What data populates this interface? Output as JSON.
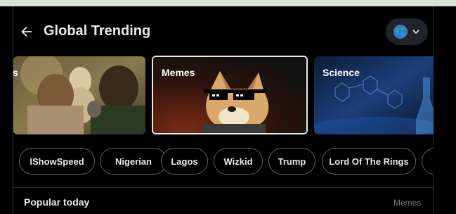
{
  "header": {
    "title": "Global Trending"
  },
  "cards": [
    {
      "label": "s"
    },
    {
      "label": "Memes"
    },
    {
      "label": "Science"
    }
  ],
  "chips": [
    "IShowSpeed",
    "Nigerian",
    "Lagos",
    "Wizkid",
    "Trump",
    "Lord Of The Rings"
  ],
  "popular": {
    "heading": "Popular today",
    "category": "Memes"
  }
}
